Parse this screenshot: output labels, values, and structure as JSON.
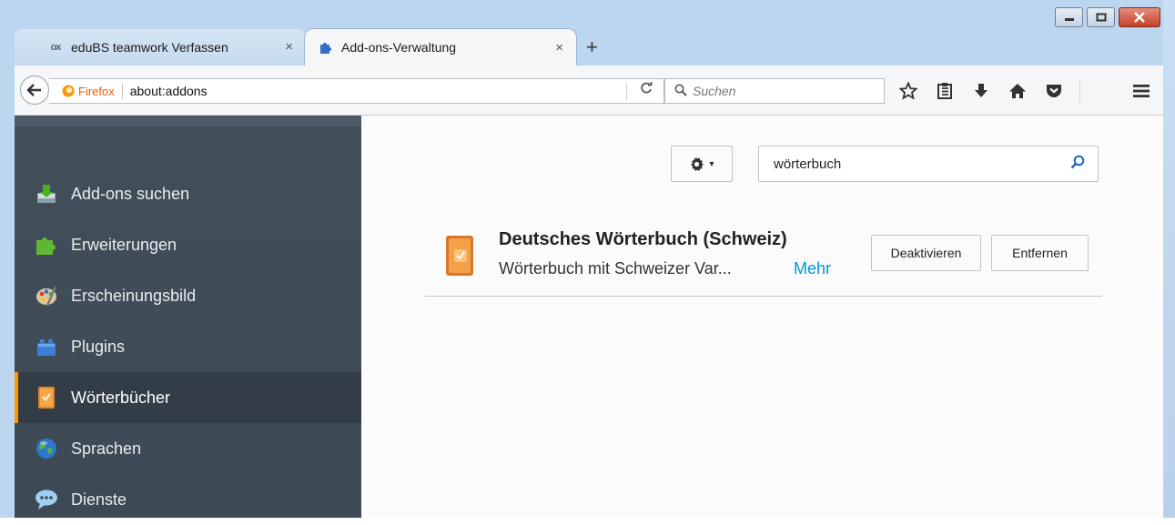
{
  "tabs": [
    {
      "label": "eduBS teamwork Verfassen",
      "icon": "ox-logo",
      "logo_text": "ox",
      "active": false
    },
    {
      "label": "Add-ons-Verwaltung",
      "icon": "puzzle-icon",
      "active": true
    }
  ],
  "tab_close_glyph": "×",
  "new_tab_glyph": "+",
  "urlbar": {
    "identity_label": "Firefox",
    "url": "about:addons"
  },
  "search": {
    "placeholder": "Suchen"
  },
  "toolbar_icons": [
    "bookmark-star-icon",
    "reading-list-icon",
    "download-icon",
    "home-icon",
    "pocket-icon"
  ],
  "sidebar": {
    "items": [
      {
        "label": "Add-ons suchen",
        "icon": "get-addons-icon",
        "selected": false
      },
      {
        "label": "Erweiterungen",
        "icon": "puzzle-icon",
        "selected": false
      },
      {
        "label": "Erscheinungsbild",
        "icon": "palette-icon",
        "selected": false
      },
      {
        "label": "Plugins",
        "icon": "plugin-brick-icon",
        "selected": false
      },
      {
        "label": "Wörterbücher",
        "icon": "dictionary-icon",
        "selected": true
      },
      {
        "label": "Sprachen",
        "icon": "globe-icon",
        "selected": false
      },
      {
        "label": "Dienste",
        "icon": "chat-bubble-icon",
        "selected": false
      }
    ]
  },
  "main": {
    "search_value": "wörterbuch",
    "addon": {
      "name": "Deutsches Wörterbuch (Schweiz)",
      "description": "Wörterbuch mit Schweizer Var...",
      "more_link": "Mehr",
      "disable_label": "Deaktivieren",
      "remove_label": "Entfernen"
    }
  },
  "colors": {
    "sidebar_bg": "#424f5a",
    "selected_accent": "#ff9500",
    "link": "#0095dd",
    "identity": "#e66000"
  }
}
